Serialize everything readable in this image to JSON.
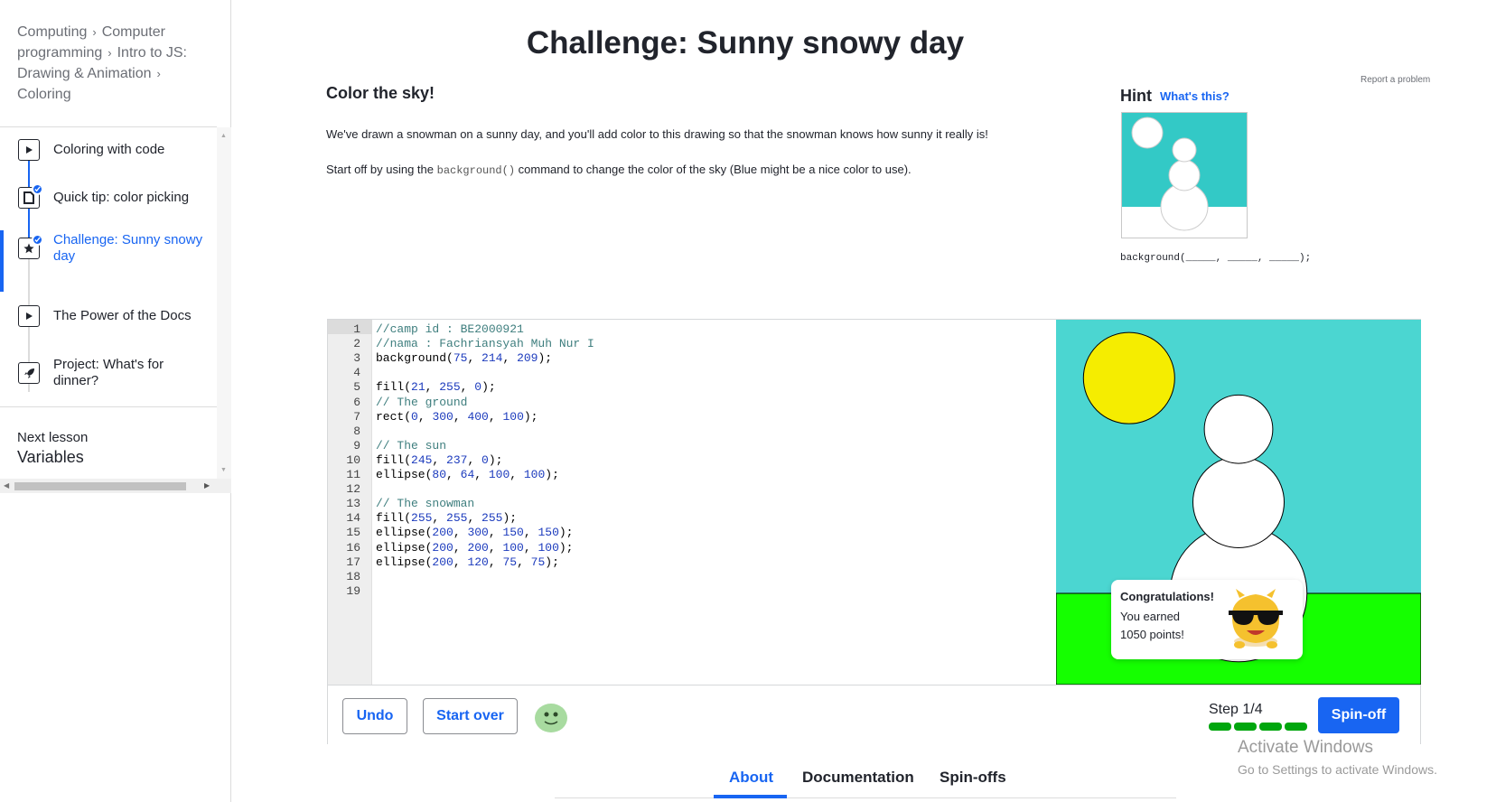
{
  "breadcrumb": {
    "items": [
      "Computing",
      "Computer programming",
      "Intro to JS: Drawing & Animation",
      "Coloring"
    ],
    "separator": "›"
  },
  "sidebar": {
    "items": [
      {
        "label": "Coloring with code",
        "icon": "play-icon",
        "completed": false,
        "active": false
      },
      {
        "label": "Quick tip: color picking",
        "icon": "article-icon",
        "completed": true,
        "active": false
      },
      {
        "label": "Challenge: Sunny snowy day",
        "icon": "star-icon",
        "completed": true,
        "active": true
      },
      {
        "label": "The Power of the Docs",
        "icon": "play-icon",
        "completed": false,
        "active": false
      },
      {
        "label": "Project: What's for dinner?",
        "icon": "rocket-icon",
        "completed": false,
        "active": false
      }
    ],
    "next_lesson_label": "Next lesson",
    "next_lesson_title": "Variables"
  },
  "main": {
    "title": "Challenge: Sunny snowy day",
    "section_heading": "Color the sky!",
    "instruction_1": "We've drawn a snowman on a sunny day, and you'll add color to this drawing so that the snowman knows how sunny it really is!",
    "instruction_2_pre": "Start off by using the ",
    "instruction_2_code": "background()",
    "instruction_2_post": " command to change the color of the sky (Blue might be a nice color to use).",
    "report_link": "Report a problem"
  },
  "hint": {
    "title": "Hint",
    "link": "What's this?",
    "code": "background(_____, _____, _____);"
  },
  "editor": {
    "lines": [
      "//camp id : BE2000921",
      "//nama : Fachriansyah Muh Nur I",
      "background(75, 214, 209);",
      "",
      "fill(21, 255, 0);",
      "// The ground",
      "rect(0, 300, 400, 100);",
      "",
      "// The sun",
      "fill(245, 237, 0);",
      "ellipse(80, 64, 100, 100);",
      "",
      "// The snowman",
      "fill(255, 255, 255);",
      "ellipse(200, 300, 150, 150);",
      "ellipse(200, 200, 100, 100);",
      "ellipse(200, 120, 75, 75);",
      "",
      ""
    ]
  },
  "toolbar": {
    "undo_label": "Undo",
    "start_over_label": "Start over",
    "step_label": "Step 1/4",
    "step_progress": 1.0,
    "spinoff_label": "Spin-off"
  },
  "congrats": {
    "title": "Congratulations!",
    "line1": "You earned",
    "line2": "1050 points!"
  },
  "watermark": {
    "title": "Activate Windows",
    "subtitle": "Go to Settings to activate Windows."
  },
  "tabs": [
    "About",
    "Documentation",
    "Spin-offs"
  ],
  "colors": {
    "accent": "#1865f2",
    "sky": "#4bd6d1",
    "ground": "#15ff00",
    "sun": "#f5ed00",
    "progress": "#00a60e"
  }
}
